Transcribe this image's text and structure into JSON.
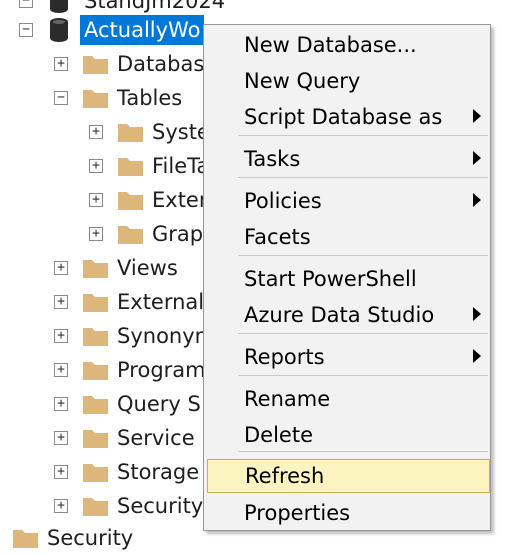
{
  "tree": {
    "top_partial_label": "StandJm2024",
    "database_label": "ActuallyWo",
    "children": [
      {
        "label": "Database",
        "toggle": "+"
      },
      {
        "label": "Tables",
        "toggle": "−"
      },
      {
        "label": "Syste",
        "toggle": "+"
      },
      {
        "label": "FileTa",
        "toggle": "+"
      },
      {
        "label": "Exter",
        "toggle": "+"
      },
      {
        "label": "Grap",
        "toggle": "+"
      },
      {
        "label": "Views",
        "toggle": "+"
      },
      {
        "label": "External",
        "toggle": "+"
      },
      {
        "label": "Synonym",
        "toggle": "+"
      },
      {
        "label": "Program",
        "toggle": "+"
      },
      {
        "label": "Query S",
        "toggle": "+"
      },
      {
        "label": "Service",
        "toggle": "+"
      },
      {
        "label": "Storage",
        "toggle": "+"
      },
      {
        "label": "Security",
        "toggle": "+"
      }
    ],
    "bottom_label": "Security",
    "db_toggle": "−"
  },
  "context_menu": {
    "items": [
      {
        "label": "New Database..."
      },
      {
        "label": "New Query"
      },
      {
        "label": "Script Database as",
        "submenu": true
      },
      {
        "label": "Tasks",
        "submenu": true
      },
      {
        "label": "Policies",
        "submenu": true
      },
      {
        "label": "Facets"
      },
      {
        "label": "Start PowerShell"
      },
      {
        "label": "Azure Data Studio",
        "submenu": true
      },
      {
        "label": "Reports",
        "submenu": true
      },
      {
        "label": "Rename"
      },
      {
        "label": "Delete"
      },
      {
        "label": "Refresh",
        "highlighted": true
      },
      {
        "label": "Properties"
      }
    ]
  },
  "colors": {
    "selection": "#0078d7",
    "folder": "#dcb67a",
    "menu_bg": "#f2f2f2",
    "highlight": "#fcf4c0"
  }
}
